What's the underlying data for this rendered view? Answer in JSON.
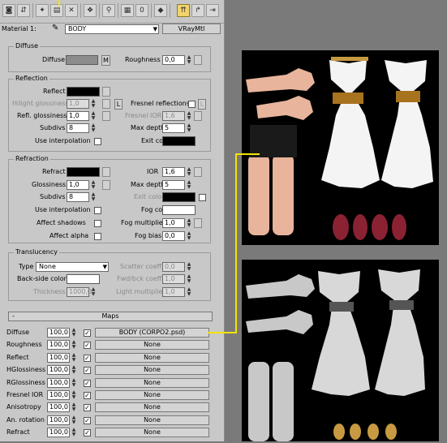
{
  "toolbar": {
    "buttons": [
      "sample-slot",
      "get-material",
      "put-to-scene",
      "assign-material",
      "reset-map",
      "make-copy",
      "make-unique",
      "put-to-library",
      "material-id",
      "show-map",
      "show-end-result",
      "go-to-parent",
      "go-forward"
    ]
  },
  "material": {
    "label": "Material 1:",
    "name": "BODY",
    "type": "VRayMtl"
  },
  "diffuse": {
    "title": "Diffuse",
    "diffuse_label": "Diffuse",
    "diffuse_color": "#8c8c8c",
    "map_button": "M",
    "roughness_label": "Roughness",
    "roughness": "0,0"
  },
  "reflection": {
    "title": "Reflection",
    "reflect_label": "Reflect",
    "reflect_color": "#000000",
    "hilight_label": "Hilight glossiness",
    "hilight": "1,0",
    "lock_label": "L",
    "fresnel_label": "Fresnel reflections",
    "refl_gloss_label": "Refl. glossiness",
    "refl_gloss": "1,0",
    "fresnel_ior_label": "Fresnel IOR",
    "fresnel_ior": "1,6",
    "subdivs_label": "Subdivs",
    "subdivs": "8",
    "max_depth_label": "Max depth",
    "max_depth": "5",
    "interp_label": "Use interpolation",
    "exit_label": "Exit color",
    "exit_color": "#000000"
  },
  "refraction": {
    "title": "Refraction",
    "refract_label": "Refract",
    "refract_color": "#000000",
    "ior_label": "IOR",
    "ior": "1,6",
    "gloss_label": "Glossiness",
    "gloss": "1,0",
    "max_depth_label": "Max depth",
    "max_depth": "5",
    "subdivs_label": "Subdivs",
    "subdivs": "8",
    "exit_label": "Exit color",
    "exit_color": "#000000",
    "interp_label": "Use interpolation",
    "fog_color_label": "Fog color",
    "fog_color": "#ffffff",
    "shadows_label": "Affect shadows",
    "fog_mult_label": "Fog multiplier",
    "fog_mult": "1,0",
    "alpha_label": "Affect alpha",
    "fog_bias_label": "Fog bias",
    "fog_bias": "0,0"
  },
  "translucency": {
    "title": "Translucency",
    "type_label": "Type",
    "type_value": "None",
    "scatter_label": "Scatter coeff",
    "scatter": "0,0",
    "backside_label": "Back-side color",
    "backside_color": "#ffffff",
    "fwd_label": "Fwd/bck coeff",
    "fwd": "1,0",
    "thickness_label": "Thickness",
    "thickness": "1000,0",
    "light_mult_label": "Light multiplier",
    "light_mult": "1,0"
  },
  "maps": {
    "collapse": "-",
    "title": "Maps",
    "rows": [
      {
        "label": "Diffuse",
        "amount": "100,0",
        "checked": "✓",
        "map": "BODY (CORPO2.psd)"
      },
      {
        "label": "Roughness",
        "amount": "100,0",
        "checked": "✓",
        "map": "None"
      },
      {
        "label": "Reflect",
        "amount": "100,0",
        "checked": "✓",
        "map": "None"
      },
      {
        "label": "HGlossiness",
        "amount": "100,0",
        "checked": "✓",
        "map": "None"
      },
      {
        "label": "RGlossiness",
        "amount": "100,0",
        "checked": "✓",
        "map": "None"
      },
      {
        "label": "Fresnel IOR",
        "amount": "100,0",
        "checked": "✓",
        "map": "None"
      },
      {
        "label": "Anisotropy",
        "amount": "100,0",
        "checked": "✓",
        "map": "None"
      },
      {
        "label": "An. rotation",
        "amount": "100,0",
        "checked": "✓",
        "map": "None"
      },
      {
        "label": "Refract",
        "amount": "100,0",
        "checked": "✓",
        "map": "None"
      }
    ]
  },
  "colors": {
    "highlight_line": "#f4e400",
    "panel": "#c8c8c8",
    "viewport_bg": "#7a7a7a"
  }
}
